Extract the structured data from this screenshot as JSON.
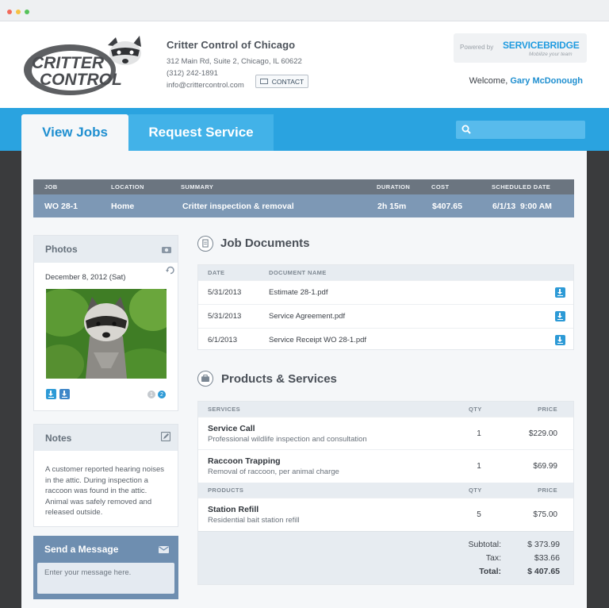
{
  "company": {
    "name": "Critter Control of Chicago",
    "address": "312 Main Rd, Suite 2, Chicago, IL 60622",
    "phone": "(312) 242-1891",
    "email": "info@crittercontrol.com",
    "contact_label": "CONTACT",
    "logo_text_1": "CRITTER",
    "logo_text_2": "CONTROL"
  },
  "powered_by": {
    "label": "Powered by",
    "brand": "SERVICEBRIDGE",
    "tagline": "Mobilize your team"
  },
  "welcome": {
    "prefix": "Welcome,",
    "user": "Gary McDonough"
  },
  "tabs": [
    {
      "label": "View Jobs",
      "active": true
    },
    {
      "label": "Request Service",
      "active": false
    }
  ],
  "search": {
    "placeholder": ""
  },
  "job": {
    "columns": [
      "JOB",
      "LOCATION",
      "SUMMARY",
      "DURATION",
      "COST",
      "SCHEDULED DATE"
    ],
    "row": {
      "job": "WO 28-1",
      "location": "Home",
      "summary": "Critter inspection & removal",
      "duration": "2h 15m",
      "cost": "$407.65",
      "scheduled": "6/1/13  9:00 AM"
    }
  },
  "photos": {
    "title": "Photos",
    "date": "December 8, 2012 (Sat)",
    "pages": [
      "1",
      "2"
    ]
  },
  "notes": {
    "title": "Notes",
    "text": "A customer reported hearing noises in the attic. During inspection a raccoon was found in the attic. Animal was safely removed and released outside."
  },
  "message": {
    "title": "Send a Message",
    "placeholder": "Enter your message here."
  },
  "documents": {
    "title": "Job Documents",
    "columns": [
      "DATE",
      "DOCUMENT NAME"
    ],
    "rows": [
      {
        "date": "5/31/2013",
        "name": "Estimate 28-1.pdf"
      },
      {
        "date": "5/31/2013",
        "name": "Service Agreement.pdf"
      },
      {
        "date": "6/1/2013",
        "name": "Service Receipt WO 28-1.pdf"
      }
    ]
  },
  "products": {
    "title": "Products & Services",
    "services_header": [
      "SERVICES",
      "QTY",
      "PRICE"
    ],
    "services": [
      {
        "name": "Service Call",
        "desc": "Professional wildlife inspection and consultation",
        "qty": "1",
        "price": "$229.00"
      },
      {
        "name": "Raccoon Trapping",
        "desc": "Removal of raccoon, per animal charge",
        "qty": "1",
        "price": "$69.99"
      }
    ],
    "products_header": [
      "PRODUCTS",
      "QTY",
      "PRICE"
    ],
    "products": [
      {
        "name": "Station Refill",
        "desc": "Residential bait station refill",
        "qty": "5",
        "price": "$75.00"
      }
    ],
    "totals": {
      "subtotal_label": "Subtotal:",
      "subtotal": "$ 373.99",
      "tax_label": "Tax:",
      "tax": "$33.66",
      "total_label": "Total:",
      "total": "$ 407.65"
    }
  },
  "colors": {
    "accent": "#2aa3e0",
    "job_row": "#7d98b5",
    "job_head": "#6b7580",
    "message_panel": "#6e8eb0"
  }
}
